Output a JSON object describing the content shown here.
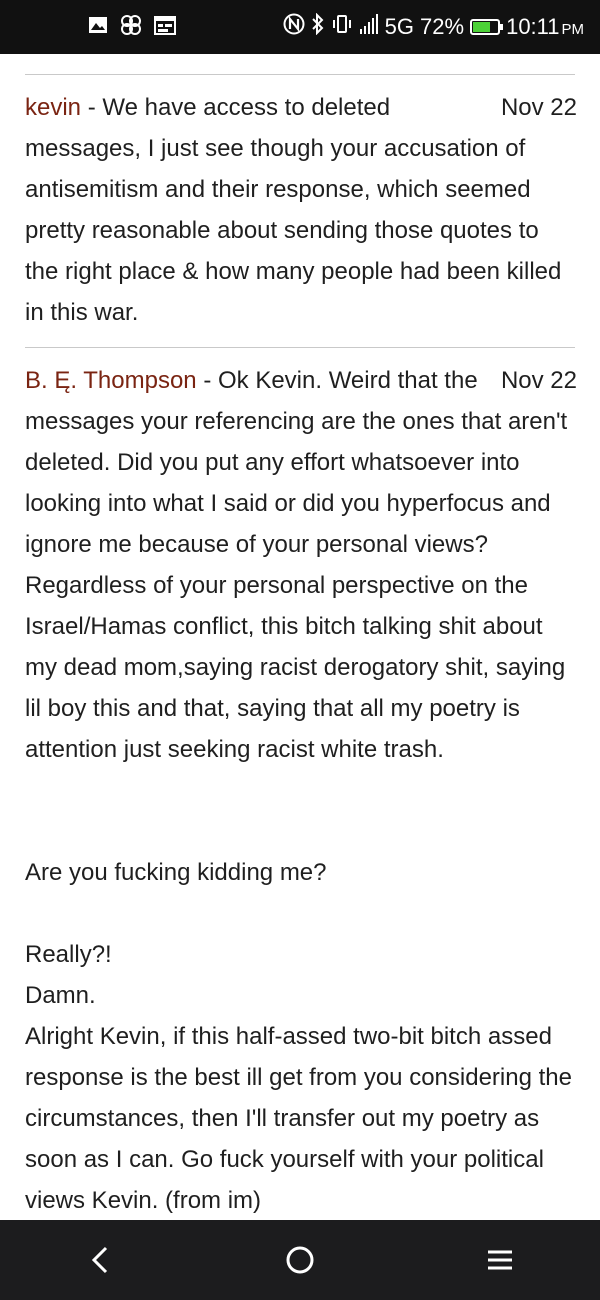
{
  "status_bar": {
    "network": "5G",
    "battery_percent": "72%",
    "battery_level": 0.72,
    "time": "10:11",
    "ampm": "PM",
    "icons": [
      "gallery-icon",
      "pinwheel-icon",
      "calendar-icon",
      "nfc-icon",
      "bluetooth-icon",
      "vibrate-icon",
      "signal-icon",
      "battery-charging-icon"
    ]
  },
  "comments": [
    {
      "author": "kevin",
      "separator": " - ",
      "date": "Nov 22",
      "text": "We have access to deleted messages, I just see though your accusation of antisemitism and their response, which seemed pretty reasonable about sending those quotes to the right place & how many people had been killed in this war."
    },
    {
      "author": "B. Ę. Thompson",
      "separator": " - ",
      "date": "Nov 22",
      "text": "Ok Kevin. Weird that the messages your referencing are the ones that aren't deleted. Did you put any effort whatsoever into looking into what I said or did you hyperfocus and ignore me because of your personal views? Regardless of your personal perspective on the Israel/Hamas conflict, this bitch talking shit about my dead mom,saying racist derogatory shit, saying lil boy this and that, saying that all my poetry is attention just seeking racist white trash.\n\n\nAre you fucking kidding me?\n\nReally?!\nDamn.\nAlright Kevin, if this half-assed two-bit bitch assed response is the best ill get from you considering the circumstances, then I'll transfer out my poetry as soon as I can. Go fuck yourself with your political views Kevin. (from im)"
    }
  ],
  "nav_bar": {
    "buttons": [
      "back-icon",
      "home-icon",
      "recents-icon"
    ]
  }
}
